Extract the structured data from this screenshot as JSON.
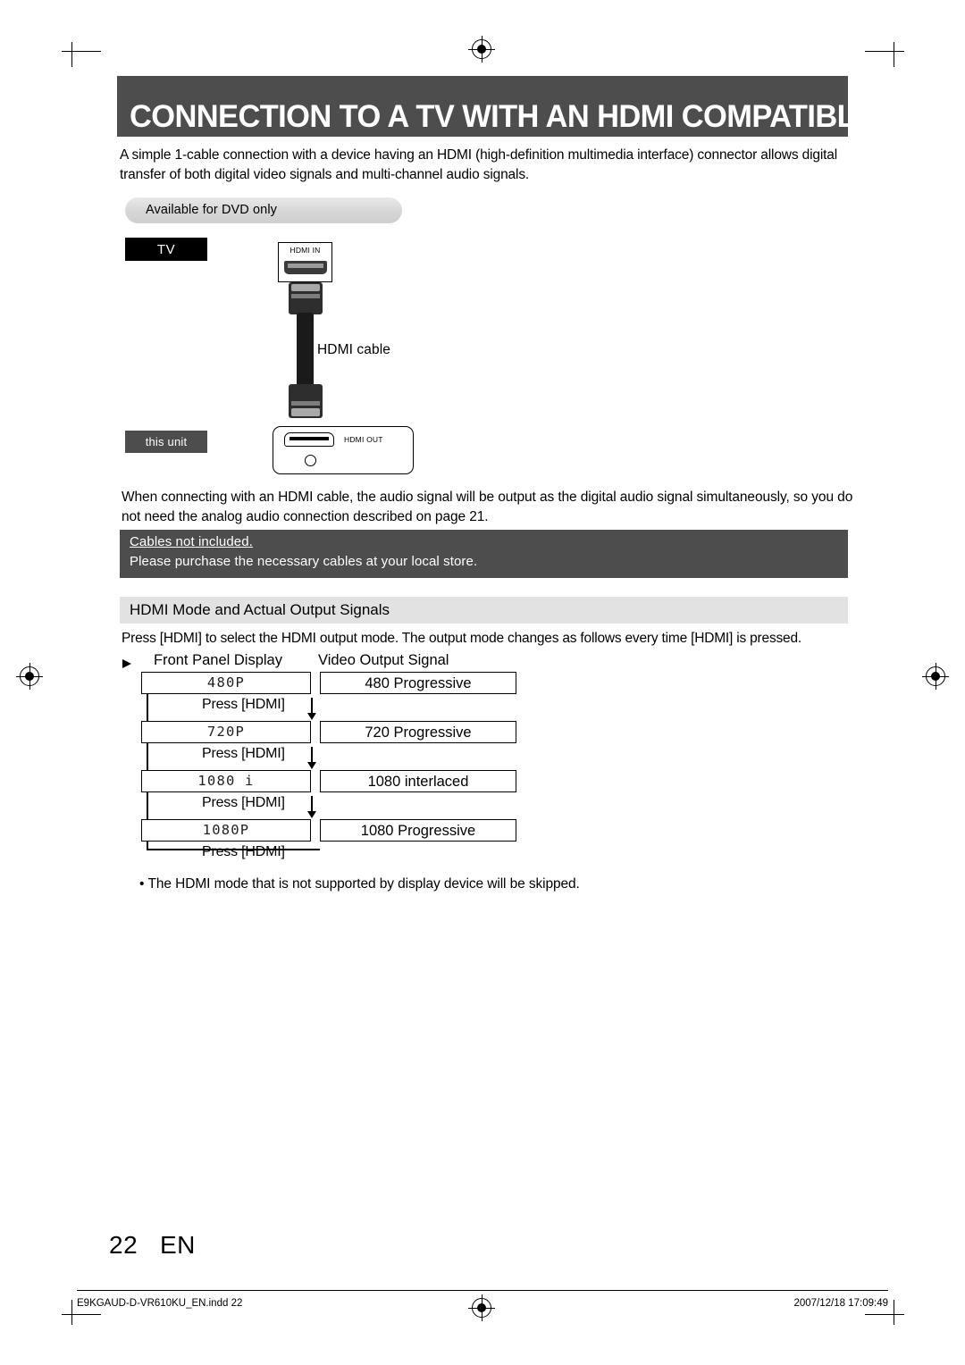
{
  "header": {
    "title": "CONNECTION TO A TV WITH AN HDMI  COMPATIBLE PORT"
  },
  "intro": {
    "text": "A simple 1-cable connection with a device having an HDMI (high-definition multimedia interface) connector allows digital transfer of both digital video signals and multi-channel audio signals."
  },
  "badge": {
    "dvd_only": "Available for DVD only"
  },
  "diagram": {
    "tv_label": "TV",
    "unit_label": "this unit",
    "tv_port_label": "HDMI IN",
    "unit_port_label": "HDMI OUT",
    "cable_caption": "HDMI cable"
  },
  "paragraph2": {
    "text": "When connecting with an HDMI cable, the audio signal will be output as the digital audio signal simultaneously, so you do not need the analog audio connection described on page 21."
  },
  "note": {
    "line1": "Cables not included.",
    "line2": "Please purchase the necessary cables at your local store."
  },
  "section": {
    "subhead": "HDMI Mode and Actual Output Signals",
    "paragraph": "Press [HDMI] to select the HDMI output mode. The output mode changes as follows every time [HDMI] is pressed."
  },
  "table": {
    "col1_header": "Front Panel Display",
    "col2_header": "Video Output Signal",
    "press_label": "Press [HDMI]",
    "rows": [
      {
        "display": "480P",
        "signal": "480 Progressive"
      },
      {
        "display": "720P",
        "signal": "720 Progressive"
      },
      {
        "display": "1080 i",
        "signal": "1080 interlaced"
      },
      {
        "display": "1080P",
        "signal": "1080 Progressive"
      }
    ]
  },
  "footnote": {
    "text": "The HDMI mode that is not supported by display device will be skipped."
  },
  "footer": {
    "page_number": "22",
    "page_lang": "EN",
    "file_name": "E9KGAUD-D-VR610KU_EN.indd   22",
    "timestamp": "2007/12/18   17:09:49"
  }
}
